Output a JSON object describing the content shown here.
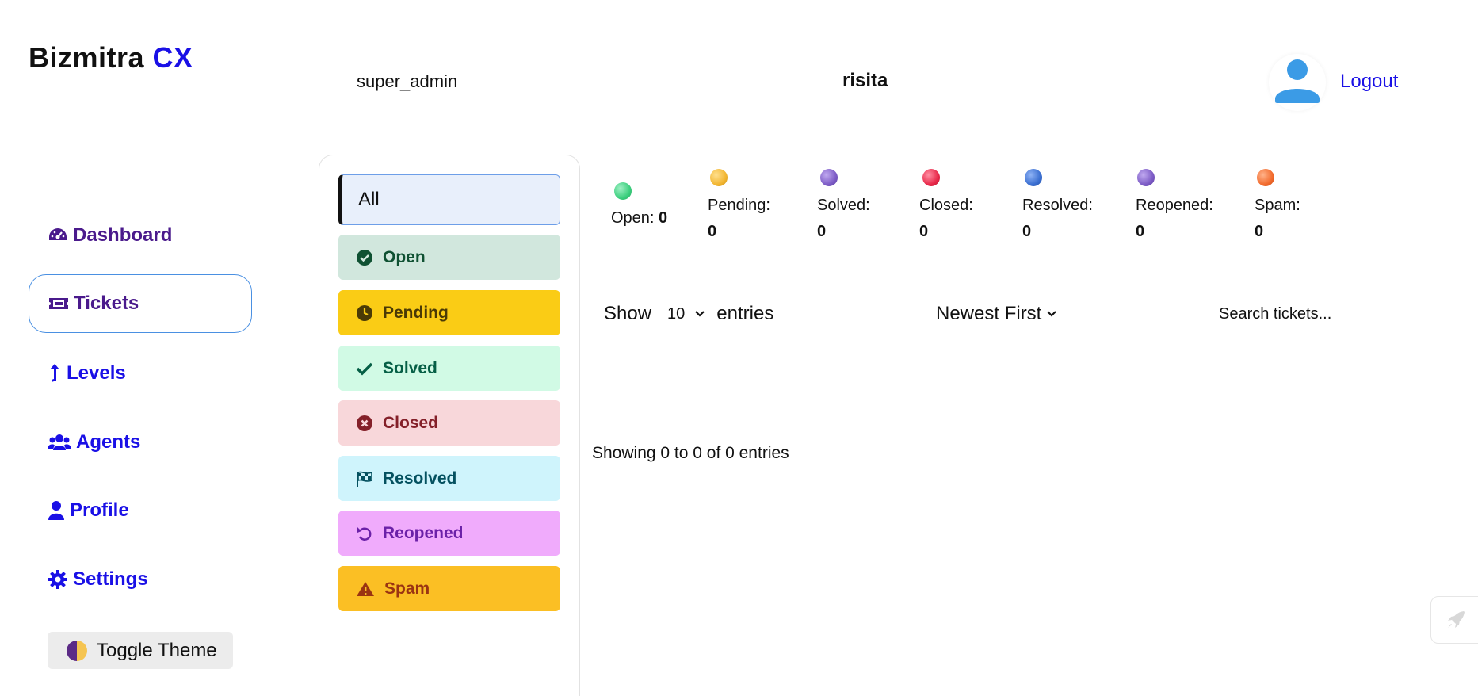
{
  "brand": {
    "name": "Bizmitra",
    "suffix": "CX"
  },
  "header": {
    "role": "super_admin",
    "username": "risita",
    "logout_label": "Logout"
  },
  "sidebar": {
    "items": [
      {
        "label": "Dashboard",
        "icon": "gauge-icon"
      },
      {
        "label": "Tickets",
        "icon": "ticket-icon",
        "active": true
      },
      {
        "label": "Levels",
        "icon": "arrow-up-icon"
      },
      {
        "label": "Agents",
        "icon": "users-icon"
      },
      {
        "label": "Profile",
        "icon": "user-icon"
      },
      {
        "label": "Settings",
        "icon": "gear-icon"
      }
    ],
    "toggle_theme_label": "Toggle Theme"
  },
  "filters": {
    "all_label": "All",
    "items": [
      {
        "label": "Open",
        "icon": "check-circle-icon",
        "bg": "#d1e7dd",
        "color": "#0f5132"
      },
      {
        "label": "Pending",
        "icon": "clock-icon",
        "bg": "#facc15",
        "color": "#4a3a06"
      },
      {
        "label": "Solved",
        "icon": "check-icon",
        "bg": "#d1fae5",
        "color": "#065f46"
      },
      {
        "label": "Closed",
        "icon": "x-circle-icon",
        "bg": "#f8d7da",
        "color": "#842029"
      },
      {
        "label": "Resolved",
        "icon": "flag-checkered-icon",
        "bg": "#cff4fc",
        "color": "#055160"
      },
      {
        "label": "Reopened",
        "icon": "undo-icon",
        "bg": "#f0abfc",
        "color": "#6b21a8"
      },
      {
        "label": "Spam",
        "icon": "warning-icon",
        "bg": "#fbbf24",
        "color": "#9a3412"
      }
    ]
  },
  "stats": {
    "open": {
      "label": "Open:",
      "value": "0",
      "color": "#3ccf7e"
    },
    "pending": {
      "label": "Pending:",
      "value": "0",
      "color": "#f2b632"
    },
    "solved": {
      "label": "Solved:",
      "value": "0",
      "color": "#7d5cc6"
    },
    "closed": {
      "label": "Closed:",
      "value": "0",
      "color": "#e8294a"
    },
    "resolved": {
      "label": "Resolved:",
      "value": "0",
      "color": "#3b6fd1"
    },
    "reopened": {
      "label": "Reopened:",
      "value": "0",
      "color": "#7d5cc6"
    },
    "spam": {
      "label": "Spam:",
      "value": "0",
      "color": "#f26b2e"
    }
  },
  "table": {
    "show_label": "Show",
    "entries_value": "10",
    "entries_label": "entries",
    "sort_label": "Newest First",
    "search_placeholder": "Search tickets...",
    "showing_text": "Showing 0 to 0 of 0 entries"
  }
}
